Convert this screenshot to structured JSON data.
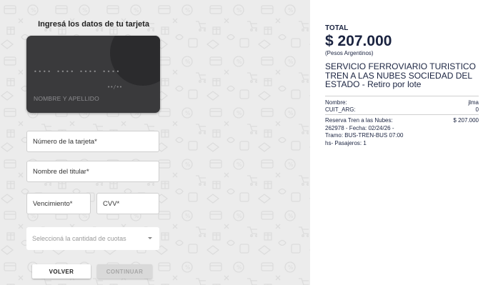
{
  "form": {
    "title": "Ingresá los datos de tu tarjeta",
    "card_preview": {
      "number_mask": "•••• •••• •••• ••••",
      "expiry_mask": "••/••",
      "holder_placeholder": "NOMBRE Y APELLIDO"
    },
    "fields": {
      "card_number": "Número de la tarjeta*",
      "holder_name": "Nombre del titular*",
      "expiry": "Vencimiento*",
      "cvv": "CVV*"
    },
    "installments_placeholder": "Seleccioná la cantidad de cuotas",
    "buttons": {
      "back": "VOLVER",
      "continue": "CONTINUAR"
    }
  },
  "summary": {
    "total_label": "TOTAL",
    "total_amount": "$ 207.000",
    "currency_note": "(Pesos Argentinos)",
    "merchant": "SERVICIO FERROVIARIO TURISTICO TREN A LAS NUBES SOCIEDAD DEL ESTADO - Retiro por lote",
    "details": [
      {
        "label": "Nombre:",
        "value": "jlma"
      },
      {
        "label": "CUIT_ARG:",
        "value": "0"
      }
    ],
    "item": {
      "description": "Reserva Tren a las Nubes: 262978 - Fecha: 02/24/26 - Tramo: BUS-TREN-BUS 07:00 hs- Pasajeros: 1",
      "price": "$ 207.000"
    }
  },
  "colors": {
    "background_pattern": "#ececec",
    "card": "#3a3a3c",
    "summary_text": "#1a2340"
  }
}
